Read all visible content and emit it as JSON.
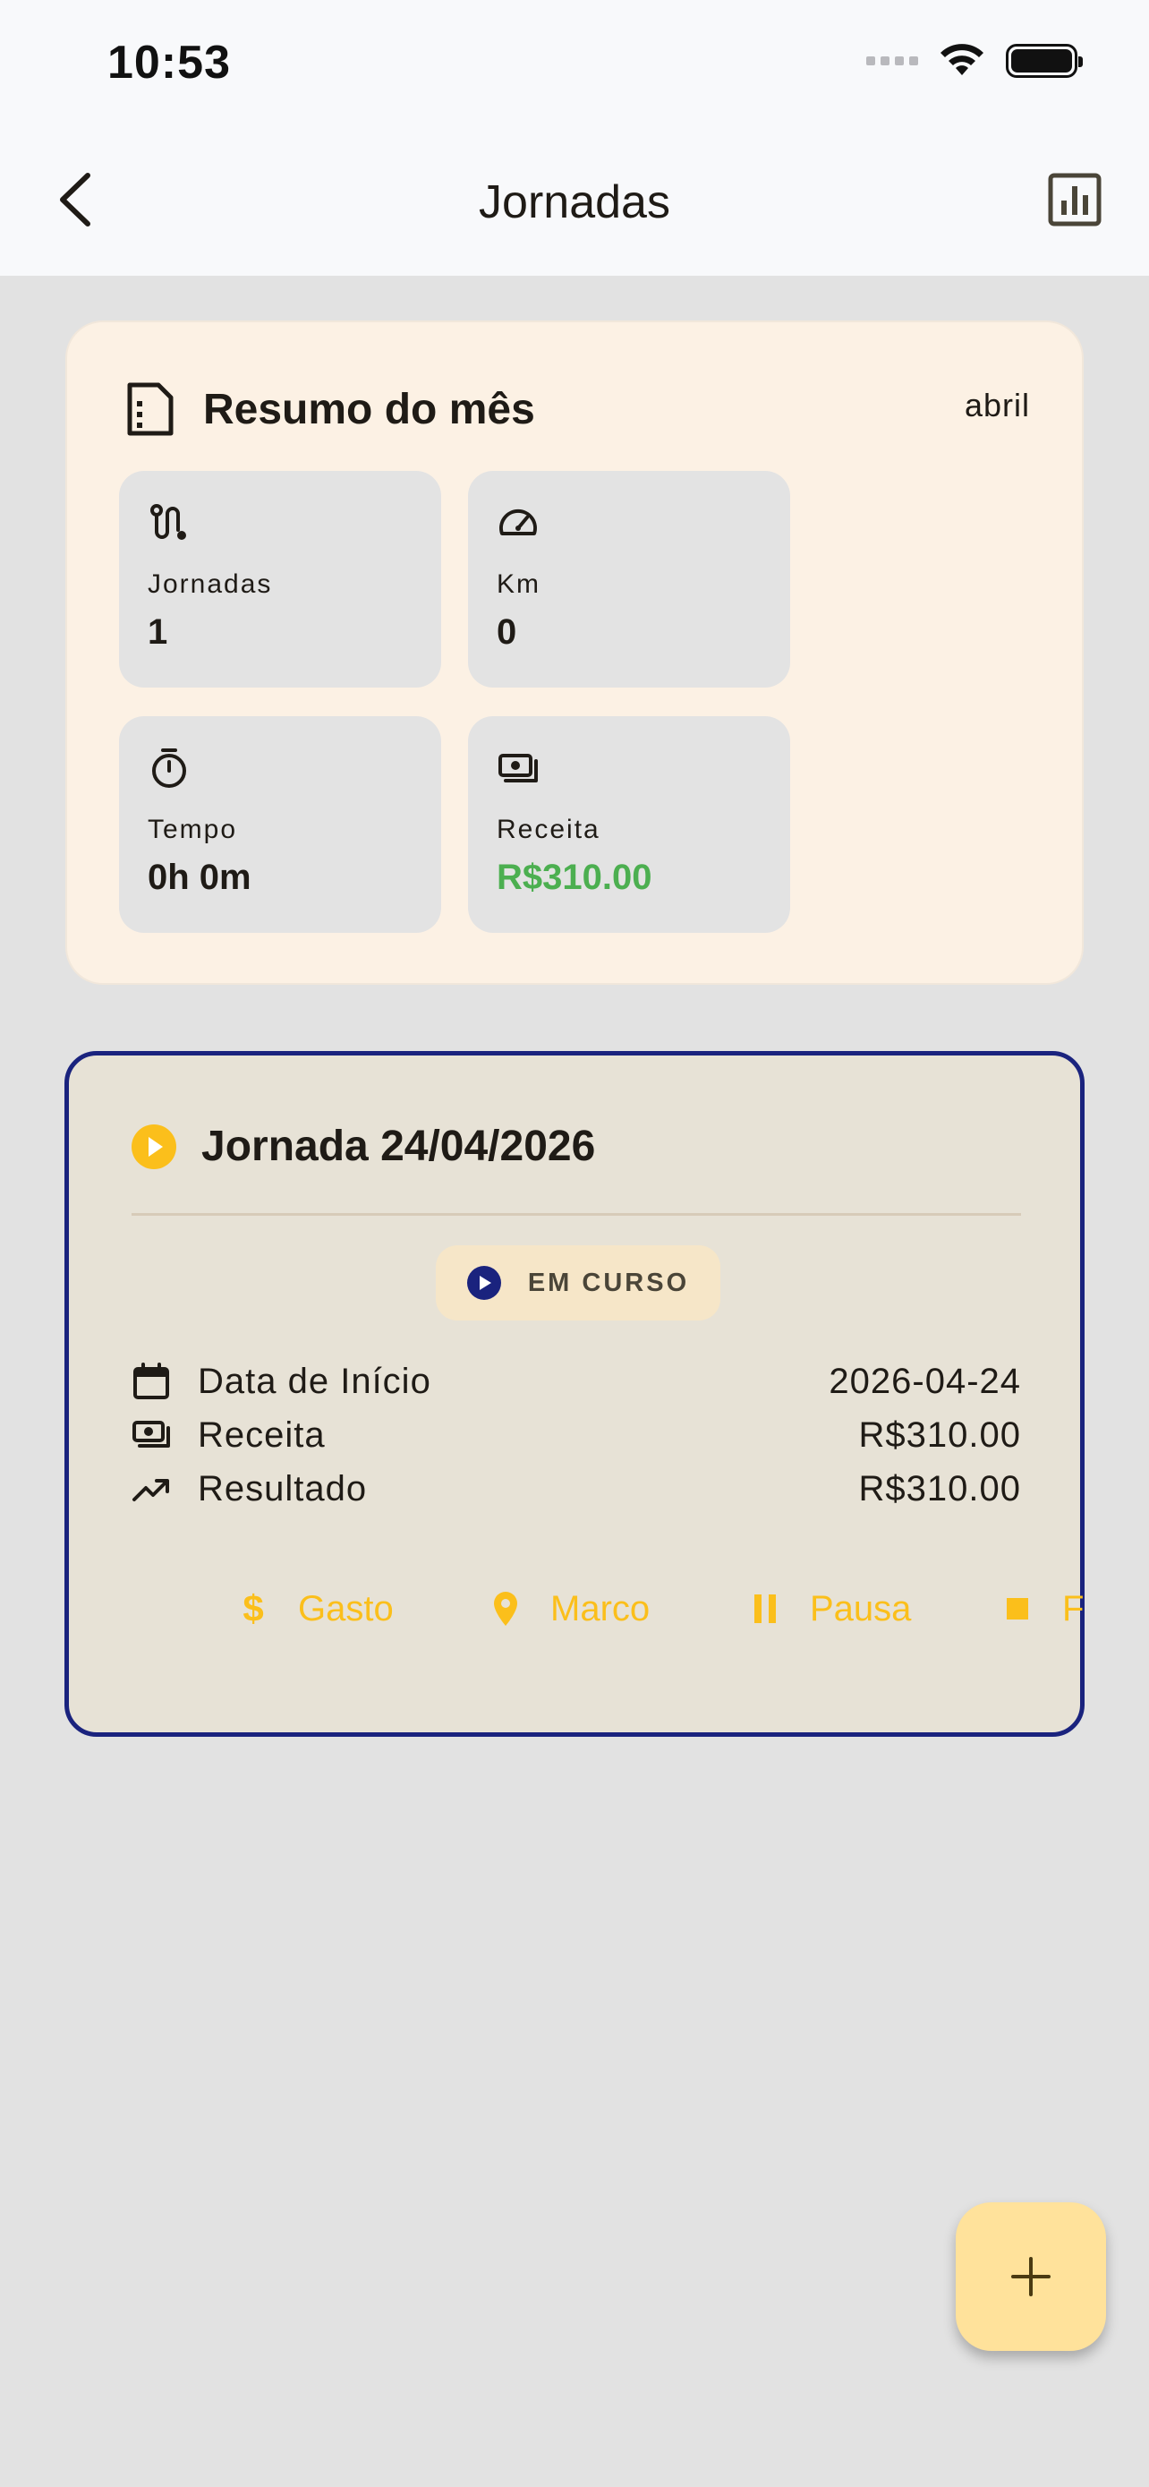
{
  "status_bar": {
    "time": "10:53"
  },
  "app_bar": {
    "title": "Jornadas"
  },
  "summary": {
    "title": "Resumo do mês",
    "month": "abril",
    "tiles": [
      {
        "label": "Jornadas",
        "value": "1",
        "icon": "route-icon"
      },
      {
        "label": "Km",
        "value": "0",
        "icon": "speedometer-icon"
      },
      {
        "label": "Tempo",
        "value": "0h 0m",
        "icon": "timer-icon"
      },
      {
        "label": "Receita",
        "value": "R$310.00",
        "icon": "payments-icon",
        "value_color": "#4caf50"
      }
    ]
  },
  "journey": {
    "title": "Jornada 24/04/2026",
    "status": "EM CURSO",
    "rows": [
      {
        "label": "Data de Início",
        "value": "2026-04-24",
        "icon": "calendar-icon"
      },
      {
        "label": "Receita",
        "value": "R$310.00",
        "icon": "payments-icon"
      },
      {
        "label": "Resultado",
        "value": "R$310.00",
        "icon": "trending-up-icon"
      }
    ],
    "actions": [
      {
        "label": "Gasto",
        "icon": "dollar-icon"
      },
      {
        "label": "Marco",
        "icon": "location-pin-icon"
      },
      {
        "label": "Pausa",
        "icon": "pause-icon"
      },
      {
        "label": "F",
        "icon": "stop-icon"
      }
    ]
  },
  "colors": {
    "accent_navy": "#1a237e",
    "accent_amber": "#fbbf1b",
    "summary_bg": "#fcf1e4",
    "journey_bg": "#e7e2d6",
    "fab_bg": "#ffe29b"
  }
}
